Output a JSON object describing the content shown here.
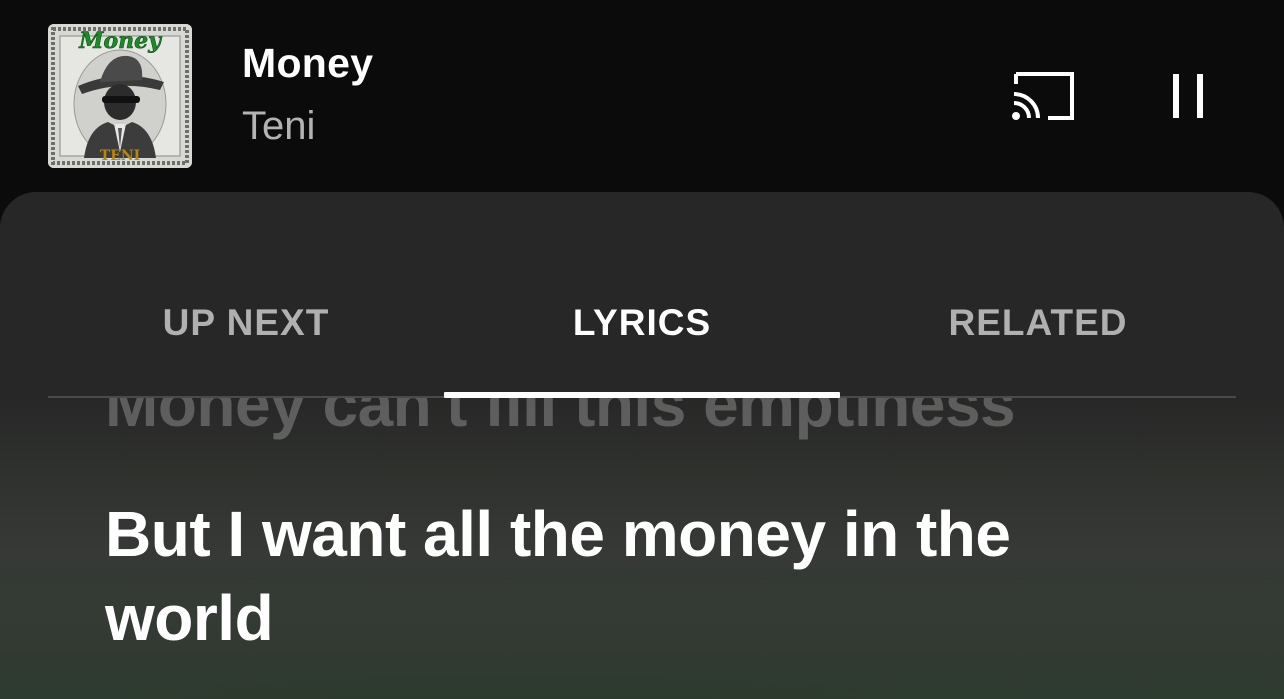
{
  "now_playing": {
    "title": "Money",
    "artist": "Teni",
    "album_art": {
      "text_top": "Money",
      "text_bottom": "TENI"
    }
  },
  "controls": {
    "cast_icon": "cast-icon",
    "pause_icon": "pause-icon"
  },
  "tabs": [
    {
      "label": "UP NEXT",
      "active": false
    },
    {
      "label": "LYRICS",
      "active": true
    },
    {
      "label": "RELATED",
      "active": false
    }
  ],
  "lyrics": {
    "previous_line": "Money can't fill this emptiness",
    "current_line": "But I want all the money in the world"
  },
  "colors": {
    "background": "#0b0b0b",
    "sheet": "#272727",
    "active_tab": "#ffffff",
    "inactive_tab": "#b0b0b0",
    "lyric_tint": "#2e3b2f"
  }
}
